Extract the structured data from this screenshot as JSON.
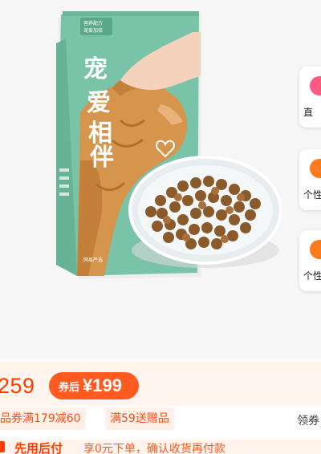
{
  "product": {
    "bag_badge_line1": "营养配方",
    "bag_badge_line2": "宠爱加倍",
    "bag_title": [
      "宠",
      "爱",
      "相",
      "伴"
    ],
    "bag_brand": "网易严选"
  },
  "side_cards": [
    {
      "label": "直",
      "color": "#ff5a82"
    },
    {
      "label": "个性",
      "color": "#ff7a1a"
    },
    {
      "label": "个性",
      "color": "#ff7a1a"
    }
  ],
  "price": {
    "original": "259",
    "coupon_label": "券后",
    "coupon_price": "¥199"
  },
  "tags": {
    "tag1": "品券满179减60",
    "tag2": "满59送赠品",
    "coupon_link": "领券"
  },
  "notice": {
    "title": "先用后付",
    "desc": "享0元下单，确认收货再付款"
  },
  "colors": {
    "accent": "#ff3d00",
    "bag_green": "#79c3a8"
  }
}
